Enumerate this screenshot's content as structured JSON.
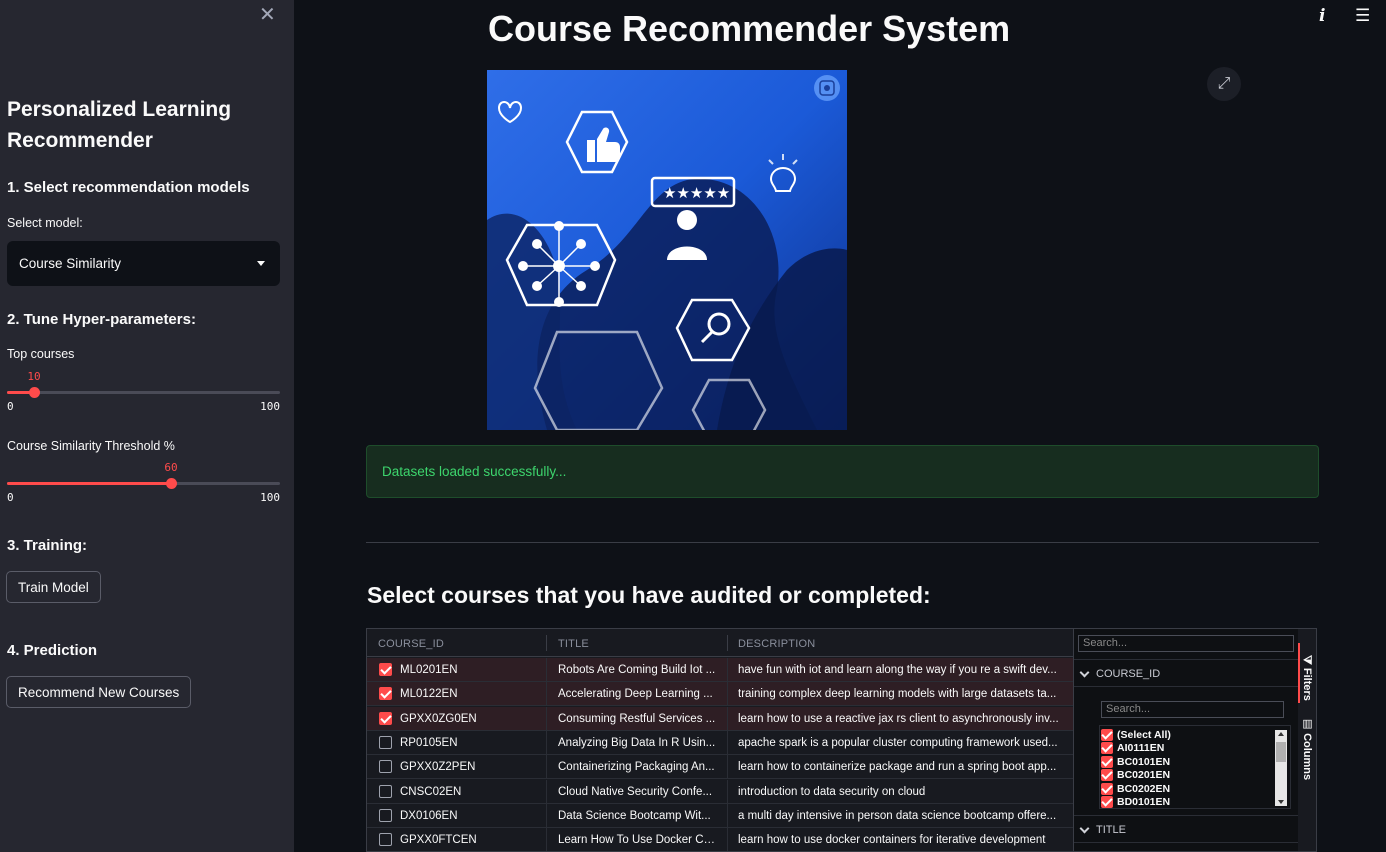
{
  "sidebar": {
    "close_icon": "close-icon",
    "title": "Personalized Learning Recommender",
    "section1": "1. Select recommendation models",
    "select_label": "Select model:",
    "select_value": "Course Similarity",
    "section2": "2. Tune Hyper-parameters:",
    "slider1": {
      "label": "Top courses",
      "value": "10",
      "min": "0",
      "max": "100",
      "fraction": 0.1
    },
    "slider2": {
      "label": "Course Similarity Threshold %",
      "value": "60",
      "min": "0",
      "max": "100",
      "fraction": 0.6
    },
    "section3": "3. Training:",
    "train_button": "Train Model",
    "section4": "4. Prediction",
    "recommend_button": "Recommend New Courses"
  },
  "header": {
    "title": "Course Recommender System",
    "icons": [
      "info-icon",
      "menu-icon"
    ]
  },
  "status": {
    "message": "Datasets loaded successfully..."
  },
  "section": {
    "title": "Select courses that you have audited or completed:"
  },
  "grid": {
    "columns": [
      "COURSE_ID",
      "TITLE",
      "DESCRIPTION"
    ],
    "rows": [
      {
        "checked": true,
        "id": "ML0201EN",
        "title": "Robots Are Coming Build Iot ...",
        "desc": "have fun with iot and learn along the way if you re a swift dev..."
      },
      {
        "checked": true,
        "id": "ML0122EN",
        "title": "Accelerating Deep Learning ...",
        "desc": "training complex deep learning models with large datasets ta..."
      },
      {
        "checked": true,
        "id": "GPXX0ZG0EN",
        "title": "Consuming Restful Services ...",
        "desc": "learn how to use a reactive jax rs client to asynchronously inv..."
      },
      {
        "checked": false,
        "id": "RP0105EN",
        "title": "Analyzing Big Data In R Usin...",
        "desc": "apache spark is a popular cluster computing framework used..."
      },
      {
        "checked": false,
        "id": "GPXX0Z2PEN",
        "title": "Containerizing Packaging An...",
        "desc": "learn how to containerize package and run a spring boot app..."
      },
      {
        "checked": false,
        "id": "CNSC02EN",
        "title": "Cloud Native Security Confe...",
        "desc": "introduction to data security on cloud"
      },
      {
        "checked": false,
        "id": "DX0106EN",
        "title": "Data Science Bootcamp Wit...",
        "desc": "a multi day intensive in person data science bootcamp offere..."
      },
      {
        "checked": false,
        "id": "GPXX0FTCEN",
        "title": "Learn How To Use Docker Co...",
        "desc": "learn how to use docker containers for iterative development"
      }
    ],
    "tool_panel": {
      "search_placeholder": "Search...",
      "group1": "COURSE_ID",
      "filter_search_placeholder": "Search...",
      "filter_items": [
        "(Select All)",
        "AI0111EN",
        "BC0101EN",
        "BC0201EN",
        "BC0202EN",
        "BD0101EN"
      ],
      "group2": "TITLE"
    },
    "side_tabs": {
      "filters": "Filters",
      "columns": "Columns"
    }
  },
  "colors": {
    "accent": "#ff4b4b",
    "success_text": "#3dd56d",
    "sidebar_bg": "#262730",
    "main_bg": "#0e1117"
  }
}
